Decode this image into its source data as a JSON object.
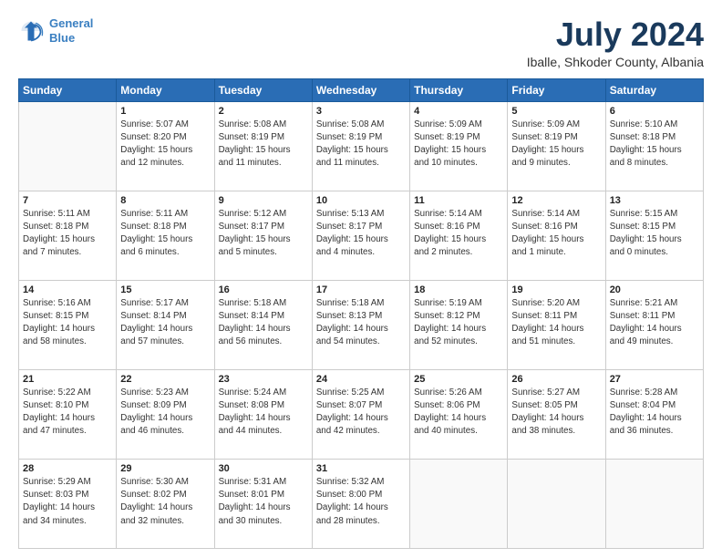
{
  "logo": {
    "line1": "General",
    "line2": "Blue"
  },
  "title": "July 2024",
  "subtitle": "Iballe, Shkoder County, Albania",
  "days_header": [
    "Sunday",
    "Monday",
    "Tuesday",
    "Wednesday",
    "Thursday",
    "Friday",
    "Saturday"
  ],
  "weeks": [
    [
      {
        "num": "",
        "info": ""
      },
      {
        "num": "1",
        "info": "Sunrise: 5:07 AM\nSunset: 8:20 PM\nDaylight: 15 hours\nand 12 minutes."
      },
      {
        "num": "2",
        "info": "Sunrise: 5:08 AM\nSunset: 8:19 PM\nDaylight: 15 hours\nand 11 minutes."
      },
      {
        "num": "3",
        "info": "Sunrise: 5:08 AM\nSunset: 8:19 PM\nDaylight: 15 hours\nand 11 minutes."
      },
      {
        "num": "4",
        "info": "Sunrise: 5:09 AM\nSunset: 8:19 PM\nDaylight: 15 hours\nand 10 minutes."
      },
      {
        "num": "5",
        "info": "Sunrise: 5:09 AM\nSunset: 8:19 PM\nDaylight: 15 hours\nand 9 minutes."
      },
      {
        "num": "6",
        "info": "Sunrise: 5:10 AM\nSunset: 8:18 PM\nDaylight: 15 hours\nand 8 minutes."
      }
    ],
    [
      {
        "num": "7",
        "info": "Sunrise: 5:11 AM\nSunset: 8:18 PM\nDaylight: 15 hours\nand 7 minutes."
      },
      {
        "num": "8",
        "info": "Sunrise: 5:11 AM\nSunset: 8:18 PM\nDaylight: 15 hours\nand 6 minutes."
      },
      {
        "num": "9",
        "info": "Sunrise: 5:12 AM\nSunset: 8:17 PM\nDaylight: 15 hours\nand 5 minutes."
      },
      {
        "num": "10",
        "info": "Sunrise: 5:13 AM\nSunset: 8:17 PM\nDaylight: 15 hours\nand 4 minutes."
      },
      {
        "num": "11",
        "info": "Sunrise: 5:14 AM\nSunset: 8:16 PM\nDaylight: 15 hours\nand 2 minutes."
      },
      {
        "num": "12",
        "info": "Sunrise: 5:14 AM\nSunset: 8:16 PM\nDaylight: 15 hours\nand 1 minute."
      },
      {
        "num": "13",
        "info": "Sunrise: 5:15 AM\nSunset: 8:15 PM\nDaylight: 15 hours\nand 0 minutes."
      }
    ],
    [
      {
        "num": "14",
        "info": "Sunrise: 5:16 AM\nSunset: 8:15 PM\nDaylight: 14 hours\nand 58 minutes."
      },
      {
        "num": "15",
        "info": "Sunrise: 5:17 AM\nSunset: 8:14 PM\nDaylight: 14 hours\nand 57 minutes."
      },
      {
        "num": "16",
        "info": "Sunrise: 5:18 AM\nSunset: 8:14 PM\nDaylight: 14 hours\nand 56 minutes."
      },
      {
        "num": "17",
        "info": "Sunrise: 5:18 AM\nSunset: 8:13 PM\nDaylight: 14 hours\nand 54 minutes."
      },
      {
        "num": "18",
        "info": "Sunrise: 5:19 AM\nSunset: 8:12 PM\nDaylight: 14 hours\nand 52 minutes."
      },
      {
        "num": "19",
        "info": "Sunrise: 5:20 AM\nSunset: 8:11 PM\nDaylight: 14 hours\nand 51 minutes."
      },
      {
        "num": "20",
        "info": "Sunrise: 5:21 AM\nSunset: 8:11 PM\nDaylight: 14 hours\nand 49 minutes."
      }
    ],
    [
      {
        "num": "21",
        "info": "Sunrise: 5:22 AM\nSunset: 8:10 PM\nDaylight: 14 hours\nand 47 minutes."
      },
      {
        "num": "22",
        "info": "Sunrise: 5:23 AM\nSunset: 8:09 PM\nDaylight: 14 hours\nand 46 minutes."
      },
      {
        "num": "23",
        "info": "Sunrise: 5:24 AM\nSunset: 8:08 PM\nDaylight: 14 hours\nand 44 minutes."
      },
      {
        "num": "24",
        "info": "Sunrise: 5:25 AM\nSunset: 8:07 PM\nDaylight: 14 hours\nand 42 minutes."
      },
      {
        "num": "25",
        "info": "Sunrise: 5:26 AM\nSunset: 8:06 PM\nDaylight: 14 hours\nand 40 minutes."
      },
      {
        "num": "26",
        "info": "Sunrise: 5:27 AM\nSunset: 8:05 PM\nDaylight: 14 hours\nand 38 minutes."
      },
      {
        "num": "27",
        "info": "Sunrise: 5:28 AM\nSunset: 8:04 PM\nDaylight: 14 hours\nand 36 minutes."
      }
    ],
    [
      {
        "num": "28",
        "info": "Sunrise: 5:29 AM\nSunset: 8:03 PM\nDaylight: 14 hours\nand 34 minutes."
      },
      {
        "num": "29",
        "info": "Sunrise: 5:30 AM\nSunset: 8:02 PM\nDaylight: 14 hours\nand 32 minutes."
      },
      {
        "num": "30",
        "info": "Sunrise: 5:31 AM\nSunset: 8:01 PM\nDaylight: 14 hours\nand 30 minutes."
      },
      {
        "num": "31",
        "info": "Sunrise: 5:32 AM\nSunset: 8:00 PM\nDaylight: 14 hours\nand 28 minutes."
      },
      {
        "num": "",
        "info": ""
      },
      {
        "num": "",
        "info": ""
      },
      {
        "num": "",
        "info": ""
      }
    ]
  ]
}
